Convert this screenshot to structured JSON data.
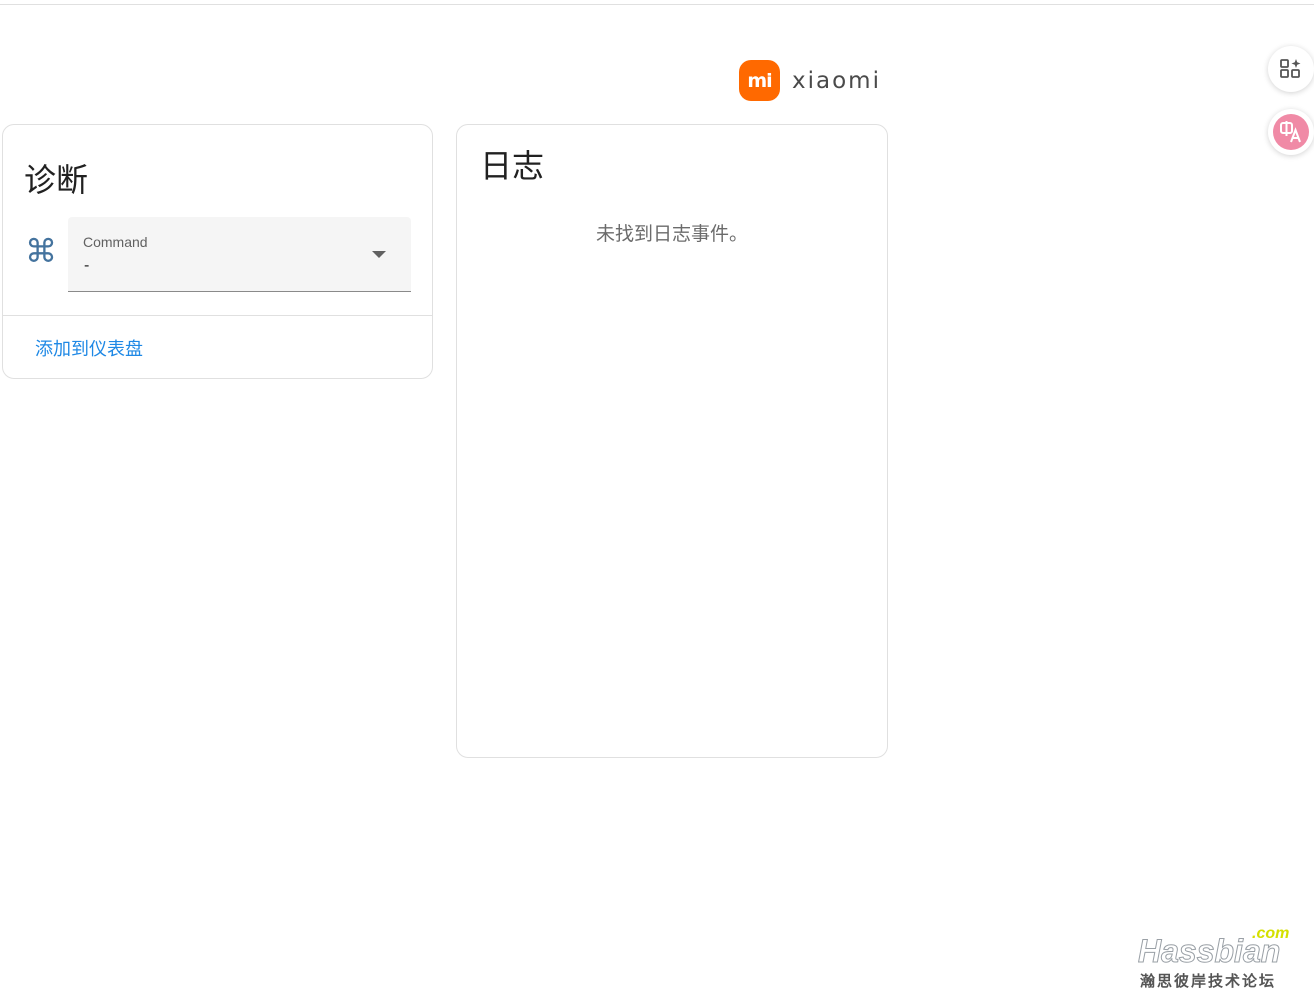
{
  "brand": {
    "logo_mark": "mi",
    "logo_word": "xiaomi",
    "accent_color": "#ff6900"
  },
  "diagnostics_card": {
    "title": "诊断",
    "command_icon": "command-icon",
    "command_glyph": "⌘",
    "select": {
      "label": "Command",
      "value": "-"
    },
    "add_to_dashboard": "添加到仪表盘"
  },
  "logbook_card": {
    "title": "日志",
    "empty_message": "未找到日志事件。"
  },
  "side_buttons": [
    {
      "icon": "apps-sparkle-icon"
    },
    {
      "icon": "translate-icon"
    }
  ],
  "watermark": {
    "com": ".com",
    "name": "Hassbian",
    "subtitle": "瀚思彼岸技术论坛"
  },
  "colors": {
    "link": "#1e88e5",
    "icon": "#44739e"
  }
}
